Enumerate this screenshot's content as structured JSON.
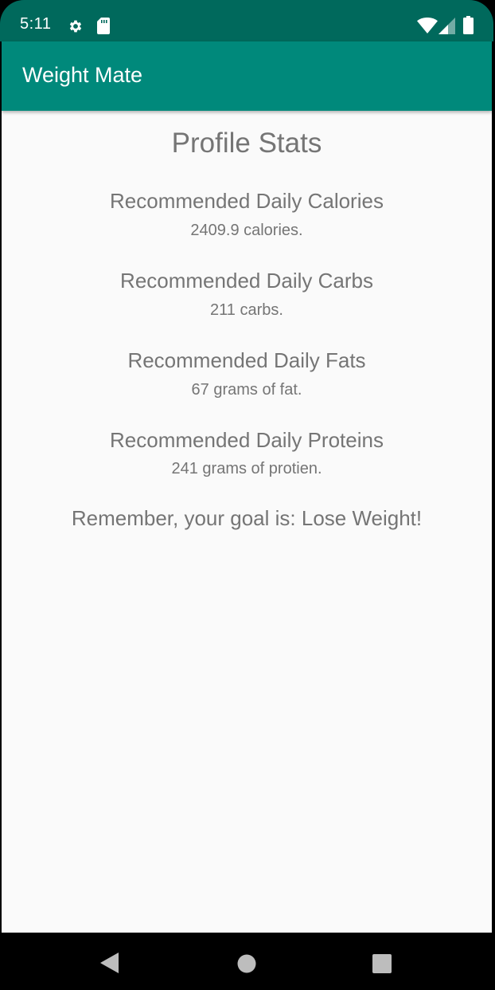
{
  "status_bar": {
    "time": "5:11",
    "icons": [
      "settings-icon",
      "sd-card-icon",
      "wifi-icon",
      "signal-icon",
      "battery-icon"
    ]
  },
  "app_bar": {
    "title": "Weight Mate"
  },
  "main": {
    "title": "Profile Stats",
    "stats": [
      {
        "label": "Recommended Daily Calories",
        "value": "2409.9 calories."
      },
      {
        "label": "Recommended Daily Carbs",
        "value": "211 carbs."
      },
      {
        "label": "Recommended Daily Fats",
        "value": "67 grams of fat."
      },
      {
        "label": "Recommended Daily Proteins",
        "value": "241 grams of protien."
      }
    ],
    "goal": "Remember, your goal is: Lose Weight!"
  },
  "nav_bar": {
    "buttons": [
      "back-icon",
      "home-icon",
      "recents-icon"
    ]
  },
  "colors": {
    "status_bar": "#00695c",
    "app_bar": "#00897b",
    "background": "#fafafa",
    "text": "#757575"
  }
}
